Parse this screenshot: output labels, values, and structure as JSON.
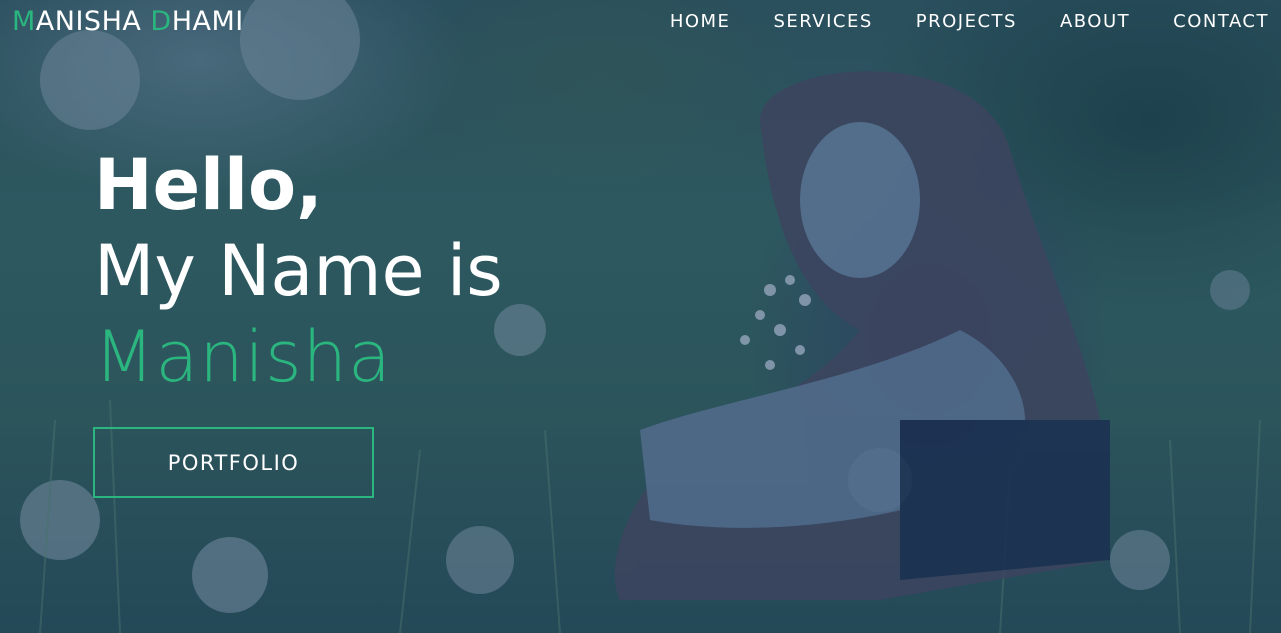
{
  "brand": {
    "first_initial": "M",
    "first_rest": "ANISHA ",
    "last_initial": "D",
    "last_rest": "HAMI",
    "accent_color": "#2bb57f"
  },
  "nav": {
    "items": [
      {
        "label": "HOME"
      },
      {
        "label": "SERVICES"
      },
      {
        "label": "PROJECTS"
      },
      {
        "label": "ABOUT"
      },
      {
        "label": "CONTACT"
      }
    ]
  },
  "hero": {
    "greeting": "Hello,",
    "intro": "My Name is",
    "name": "Manisha",
    "cta_label": "PORTFOLIO",
    "overlay_color": "#16376e"
  }
}
